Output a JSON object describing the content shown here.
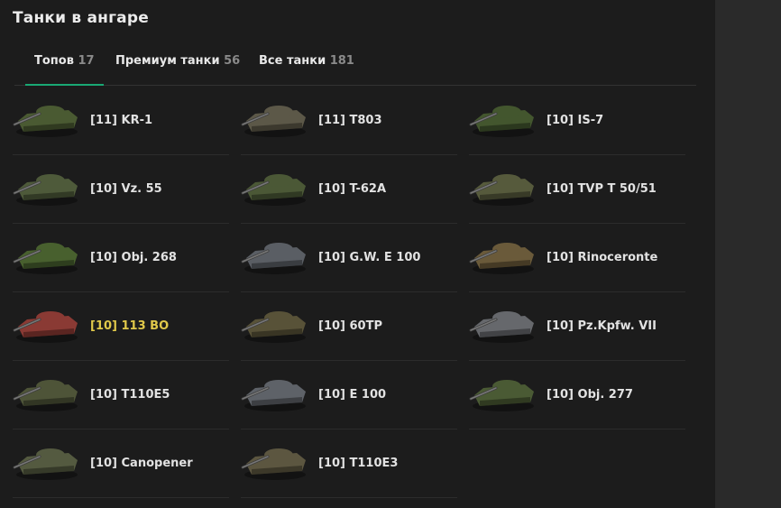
{
  "title": "Танки в ангаре",
  "tabs": [
    {
      "label": "Топов",
      "count": "17"
    },
    {
      "label": "Премиум танки",
      "count": "56"
    },
    {
      "label": "Все танки",
      "count": "181"
    }
  ],
  "tanks": [
    {
      "tier": "[11]",
      "name": "KR-1",
      "color": "#4a5a32"
    },
    {
      "tier": "[11]",
      "name": "T803",
      "color": "#5c5848"
    },
    {
      "tier": "[10]",
      "name": "IS-7",
      "color": "#43562e"
    },
    {
      "tier": "[10]",
      "name": "Vz. 55",
      "color": "#4e5a3a"
    },
    {
      "tier": "[10]",
      "name": "T-62A",
      "color": "#4b5836"
    },
    {
      "tier": "[10]",
      "name": "TVP T 50/51",
      "color": "#565a3c"
    },
    {
      "tier": "[10]",
      "name": "Obj. 268",
      "color": "#48602e"
    },
    {
      "tier": "[10]",
      "name": "G.W. E 100",
      "color": "#5a5e64"
    },
    {
      "tier": "[10]",
      "name": "Rinoceronte",
      "color": "#6a5a3a"
    },
    {
      "tier": "[10]",
      "name": "113 BO",
      "color": "#8a3a34",
      "premium": true
    },
    {
      "tier": "[10]",
      "name": "60TP",
      "color": "#585238"
    },
    {
      "tier": "[10]",
      "name": "Pz.Kpfw. VII",
      "color": "#66686c"
    },
    {
      "tier": "[10]",
      "name": "T110E5",
      "color": "#4e5438"
    },
    {
      "tier": "[10]",
      "name": "E 100",
      "color": "#5e6268"
    },
    {
      "tier": "[10]",
      "name": "Obj. 277",
      "color": "#4a5a34"
    },
    {
      "tier": "[10]",
      "name": "Canopener",
      "color": "#545a40"
    },
    {
      "tier": "[10]",
      "name": "T110E3",
      "color": "#5c5640"
    }
  ],
  "colors": {
    "accent": "#19a874",
    "premium_name": "#e0c84a"
  }
}
